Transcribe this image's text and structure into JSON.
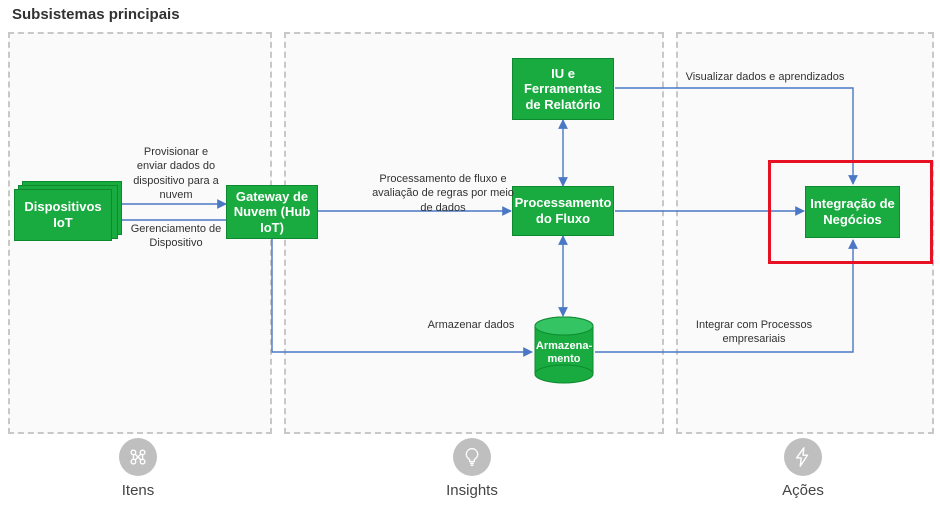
{
  "header": {
    "title": "Subsistemas principais"
  },
  "regions": {
    "itens": {
      "caption": "Itens"
    },
    "insights": {
      "caption": "Insights"
    },
    "acoes": {
      "caption": "Ações"
    }
  },
  "nodes": {
    "devices": {
      "label": "Dispositivos IoT"
    },
    "gateway": {
      "label": "Gateway de Nuvem (Hub IoT)"
    },
    "stream": {
      "label": "Processamento do Fluxo"
    },
    "ui": {
      "label": "IU e Ferramentas de Relatório"
    },
    "storage": {
      "label": "Armazena-\nmento"
    },
    "business": {
      "label": "Integração de Negócios"
    }
  },
  "edges": {
    "provision": "Provisionar e enviar dados do dispositivo para a nuvem",
    "manage": "Gerenciamento de Dispositivo",
    "process": "Processamento de fluxo e avaliação de regras por meio de dados",
    "store": "Armazenar dados",
    "integrate": "Integrar com Processos empresariais",
    "visualize": "Visualizar dados e aprendizados"
  },
  "colors": {
    "node_fill": "#1aab40",
    "node_border": "#0d8a2f",
    "edge": "#4a78c4",
    "dash": "#c8c8c8",
    "highlight": "#e81123"
  }
}
